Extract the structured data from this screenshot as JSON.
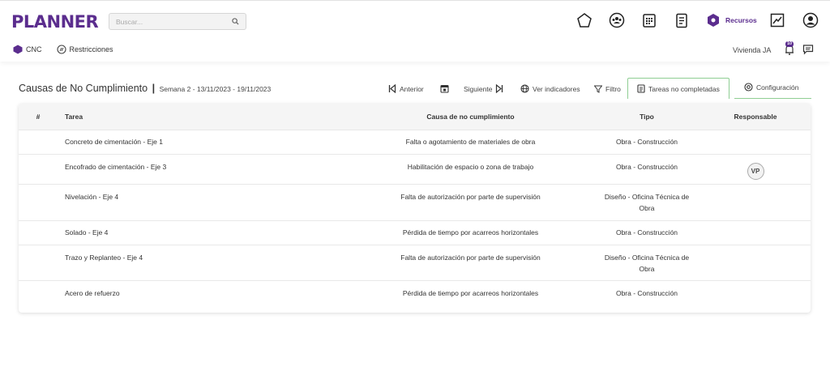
{
  "app": {
    "logo": "PLANNER"
  },
  "search": {
    "placeholder": "Buscar..."
  },
  "nav": {
    "recursos_label": "Recursos",
    "icons": [
      "pentagon-icon",
      "group-icon",
      "calendar-icon",
      "checklist-icon",
      "recursos-icon",
      "chart-icon",
      "user-icon"
    ]
  },
  "subnav": {
    "cnc": "CNC",
    "restricciones": "Restricciones"
  },
  "project": {
    "name": "Vivienda JA",
    "notifications": "10"
  },
  "page": {
    "title": "Causas de No Cumplimiento",
    "separator": "|",
    "week": "Semana 2 - 13/11/2023 - 19/11/2023"
  },
  "toolbar": {
    "anterior": "Anterior",
    "siguiente": "Siguiente",
    "ver_indicadores": "Ver indicadores",
    "filtro": "Filtro",
    "tareas_no_completadas": "Tareas no completadas",
    "configuracion": "Configuración"
  },
  "table": {
    "headers": [
      "#",
      "Tarea",
      "Causa de no cumplimiento",
      "Tipo",
      "Responsable"
    ],
    "rows": [
      {
        "tarea": "Concreto de cimentación - Eje 1",
        "causa": "Falta o agotamiento de materiales de obra",
        "tipo": [
          "Obra - Construcción"
        ],
        "responsable": ""
      },
      {
        "tarea": "Encofrado de cimentación - Eje 3",
        "causa": "Habilitación de espacio o zona de trabajo",
        "tipo": [
          "Obra - Construcción"
        ],
        "responsable": "VP"
      },
      {
        "tarea": "Nivelación - Eje 4",
        "causa": "Falta de autorización por parte de supervisión",
        "tipo": [
          "Diseño - Oficina Técnica de",
          "Obra"
        ],
        "responsable": ""
      },
      {
        "tarea": "Solado - Eje 4",
        "causa": "Pérdida de tiempo por acarreos horizontales",
        "tipo": [
          "Obra - Construcción"
        ],
        "responsable": ""
      },
      {
        "tarea": "Trazo y Replanteo - Eje 4",
        "causa": "Falta de autorización por parte de supervisión",
        "tipo": [
          "Diseño - Oficina Técnica de",
          "Obra"
        ],
        "responsable": ""
      },
      {
        "tarea": "Acero de refuerzo",
        "causa": "Pérdida de tiempo por acarreos horizontales",
        "tipo": [
          "Obra - Construcción"
        ],
        "responsable": ""
      }
    ]
  },
  "colors": {
    "brand": "#5b2d8e",
    "active_tab_border": "#8fce93"
  }
}
